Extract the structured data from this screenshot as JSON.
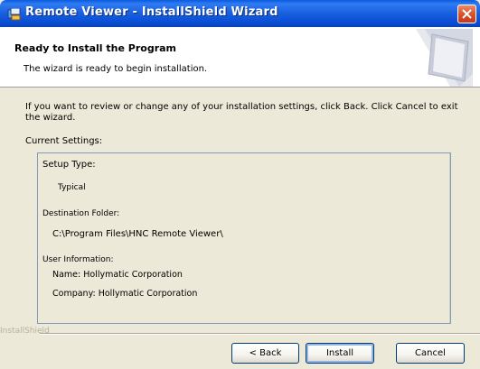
{
  "window": {
    "title": "Remote Viewer - InstallShield Wizard"
  },
  "header": {
    "title": "Ready to Install the Program",
    "subtitle": "The wizard is ready to begin installation."
  },
  "body": {
    "intro": "If you want to review or change any of your installation settings, click Back. Click Cancel to exit the wizard.",
    "settings_label": "Current Settings:"
  },
  "settings": {
    "setup_type_label": "Setup Type:",
    "setup_type_value": "Typical",
    "destination_label": "Destination Folder:",
    "destination_value": "C:\\Program Files\\HNC Remote Viewer\\",
    "user_info_label": "User Information:",
    "name_line": "Name: Hollymatic Corporation",
    "company_line": "Company: Hollymatic Corporation"
  },
  "footer": {
    "brand": "InstallShield",
    "back_label": "< Back",
    "install_label": "Install",
    "cancel_label": "Cancel"
  },
  "icons": {
    "app": "installer-icon",
    "close": "close-icon"
  },
  "colors": {
    "titlebar": "#0a5be0",
    "close": "#d9532e",
    "dialog": "#ece9d8"
  }
}
